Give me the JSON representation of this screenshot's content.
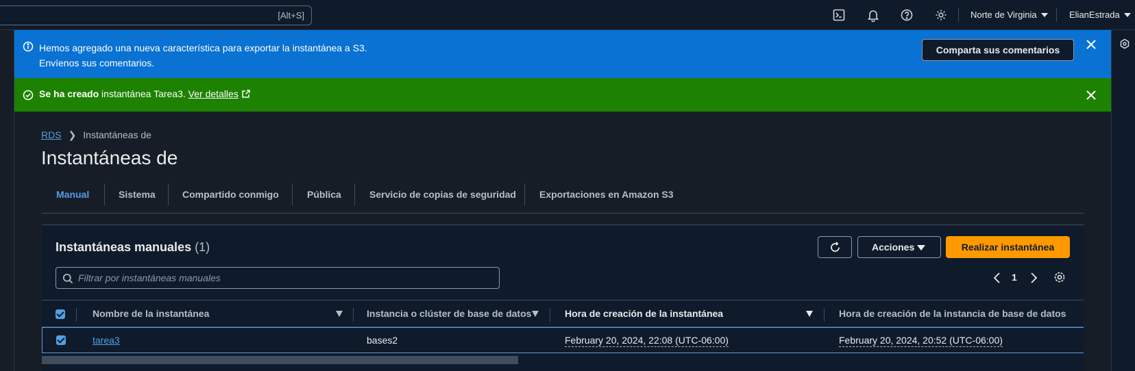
{
  "topbar": {
    "search_shortcut": "[Alt+S]",
    "region": "Norte de Virginia",
    "user": "ElianEstrada",
    "icons": [
      "cloudshell-icon",
      "notifications-icon",
      "help-icon",
      "settings-icon"
    ]
  },
  "flash_info": {
    "line1": "Hemos agregado una nueva característica para exportar la instantánea a S3.",
    "line2": "Envíenos sus comentarios.",
    "button": "Comparta sus comentarios",
    "color": "#0972d3"
  },
  "flash_success": {
    "bold": "Se ha creado",
    "text": " instantánea Tarea3. ",
    "link": "Ver detalles",
    "color": "#1d8102"
  },
  "breadcrumb": {
    "root": "RDS",
    "current": "Instantáneas de"
  },
  "page_title": "Instantáneas de",
  "tabs": [
    {
      "label": "Manual",
      "active": true
    },
    {
      "label": "Sistema",
      "active": false
    },
    {
      "label": "Compartido conmigo",
      "active": false
    },
    {
      "label": "Pública",
      "active": false
    },
    {
      "label": "Servicio de copias de seguridad",
      "active": false
    },
    {
      "label": "Exportaciones en Amazon S3",
      "active": false
    }
  ],
  "container": {
    "title": "Instantáneas manuales",
    "count": "(1)",
    "actions_label": "Acciones",
    "primary_label": "Realizar instantánea",
    "filter_placeholder": "Filtrar por instantáneas manuales",
    "page": "1"
  },
  "table": {
    "columns": [
      "Nombre de la instantánea",
      "Instancia o clúster de base de datos",
      "Hora de creación de la instantánea",
      "Hora de creación de la instancia de base de datos"
    ],
    "rows": [
      {
        "selected": true,
        "name": "tarea3",
        "instance": "bases2",
        "snapshot_time": "February 20, 2024, 22:08 (UTC-06:00)",
        "instance_time": "February 20, 2024, 20:52 (UTC-06:00)"
      }
    ]
  },
  "colors": {
    "accent": "#539fe5",
    "primary_button": "#ff9900",
    "background": "#0f1b2a"
  }
}
